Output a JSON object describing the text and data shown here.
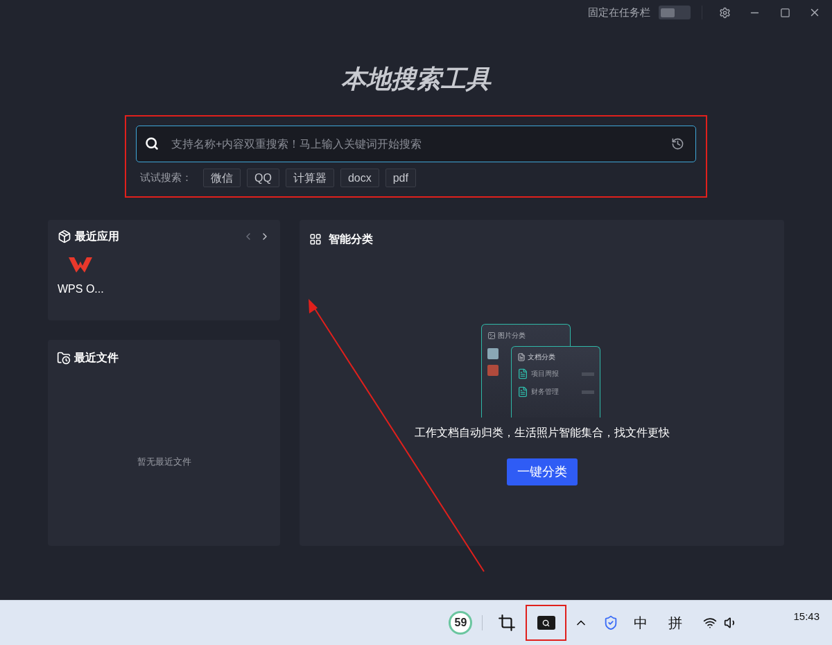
{
  "window": {
    "pin_label": "固定在任务栏",
    "pin_on": false
  },
  "title": "本地搜索工具",
  "search": {
    "placeholder": "支持名称+内容双重搜索！马上输入关键词开始搜索"
  },
  "suggestions": {
    "label": "试试搜索：",
    "items": [
      "微信",
      "QQ",
      "计算器",
      "docx",
      "pdf"
    ]
  },
  "recent_apps": {
    "title": "最近应用",
    "items": [
      {
        "name": "WPS O..."
      }
    ]
  },
  "recent_files": {
    "title": "最近文件",
    "empty_text": "暂无最近文件"
  },
  "smart": {
    "title": "智能分类",
    "photo_card": "图片分类",
    "doc_card": "文档分类",
    "doc_items": [
      "项目周报",
      "财务管理"
    ],
    "description": "工作文档自动归类，生活照片智能集合，找文件更快",
    "button": "一键分类"
  },
  "taskbar": {
    "gauge": "59",
    "ime_mode": "中",
    "ime": "拼",
    "time": "15:43"
  }
}
